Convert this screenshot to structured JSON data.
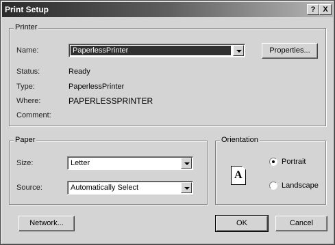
{
  "window": {
    "title": "Print Setup",
    "help_label": "?",
    "close_label": "X"
  },
  "printer": {
    "group_label": "Printer",
    "name_label": "Name:",
    "name_value": "PaperlessPrinter",
    "properties_label": "Properties...",
    "status_label": "Status:",
    "status_value": "Ready",
    "type_label": "Type:",
    "type_value": "PaperlessPrinter",
    "where_label": "Where:",
    "where_value": "PAPERLESSPRINTER",
    "comment_label": "Comment:",
    "comment_value": ""
  },
  "paper": {
    "group_label": "Paper",
    "size_label": "Size:",
    "size_value": "Letter",
    "source_label": "Source:",
    "source_value": "Automatically Select"
  },
  "orientation": {
    "group_label": "Orientation",
    "icon_letter": "A",
    "portrait_label": "Portrait",
    "landscape_label": "Landscape",
    "selected": "Portrait"
  },
  "buttons": {
    "network_label": "Network...",
    "ok_label": "OK",
    "cancel_label": "Cancel"
  }
}
